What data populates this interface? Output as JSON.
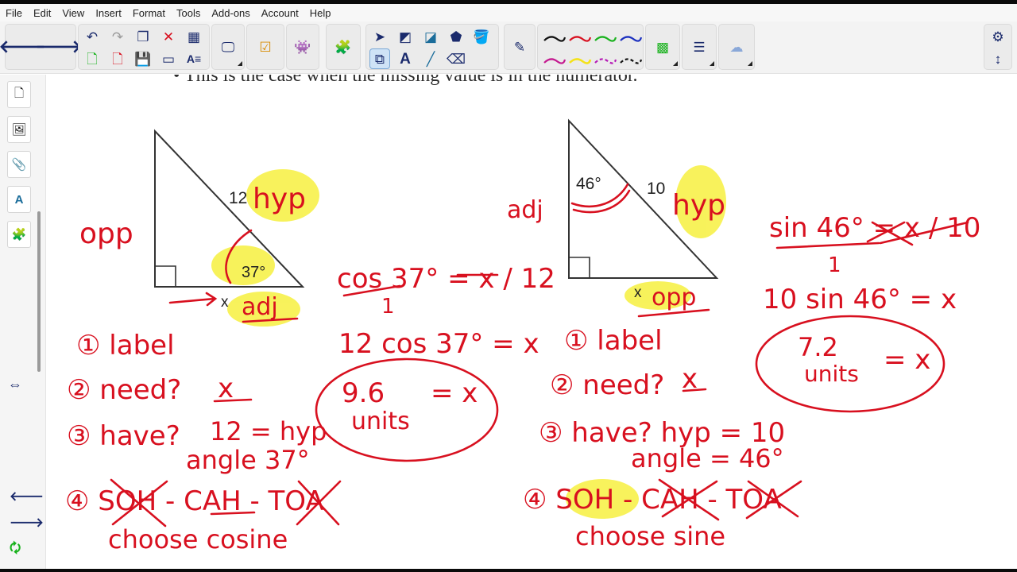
{
  "menu": [
    "File",
    "Edit",
    "View",
    "Insert",
    "Format",
    "Tools",
    "Add-ons",
    "Account",
    "Help"
  ],
  "toolbar": {
    "icons": [
      "back-arrow-icon",
      "forward-arrow-icon",
      "undo-icon",
      "redo-icon",
      "new-page-icon",
      "new-slide-icon",
      "close-red-x-icon",
      "delete-page-icon",
      "table-icon",
      "save-icon",
      "screen-icon",
      "text-format-icon",
      "presentation-icon",
      "checklist-icon",
      "robot-icon",
      "puzzle-icon",
      "select-arrow-icon",
      "sticky-note-icon",
      "shapes-icon",
      "polygon-icon",
      "fill-bucket-icon",
      "multi-select-icon",
      "text-tool-icon",
      "line-tool-icon",
      "eraser-icon",
      "pen-icon",
      "color-palette-icon",
      "line-weight-icon",
      "cloud-user-icon",
      "gear-icon",
      "up-down-arrow-icon"
    ],
    "pen_colors": [
      "#111111",
      "#d8101f",
      "#19b21d",
      "#1b2fbf",
      "#c4198f",
      "#f4e21a",
      "#b51ab5",
      "#111111"
    ]
  },
  "sidebar": {
    "icons": [
      "page-icon",
      "image-icon",
      "paperclip-icon",
      "text-style-icon",
      "puzzle-icon"
    ],
    "expand_icon": "left-right-arrow-icon",
    "nav_icons": [
      "left-arrow-icon",
      "right-arrow-icon",
      "page-refresh-icon"
    ]
  },
  "document": {
    "text": "This is the case when the missing value is in the numerator."
  },
  "left_problem": {
    "side_hyp": "12",
    "angle": "37°",
    "unknown": "x",
    "label_hyp": "hyp",
    "label_opp": "opp",
    "label_adj": "adj",
    "work": [
      "cos 37° = x / 12",
      "1",
      "12 cos 37° = x"
    ],
    "answer_line1": "9.6",
    "answer_eq": "= x",
    "answer_line2": "units",
    "steps": {
      "s1": "① label",
      "s2": "② need?",
      "s2_val": "x",
      "s3": "③ have?",
      "s3_val": "12 = hyp",
      "s3_val2": "angle 37°",
      "s4": "④ SOH - CAH - TOA",
      "s4_choose": "choose cosine"
    }
  },
  "right_problem": {
    "side_hyp": "10",
    "angle": "46°",
    "unknown": "x",
    "label_hyp": "hyp",
    "label_adj": "adj",
    "label_opp": "opp",
    "work": [
      "sin 46° = x / 10",
      "1",
      "10 sin 46° = x"
    ],
    "answer_line1": "7.2",
    "answer_eq": "= x",
    "answer_line2": "units",
    "steps": {
      "s1": "① label",
      "s2": "② need?",
      "s2_val": "x",
      "s3": "③ have? hyp = 10",
      "s3_val2": "angle = 46°",
      "s4": "④ SOH - CAH - TOA",
      "s4_choose": "choose sine"
    }
  },
  "colors": {
    "ink_red": "#d8101f",
    "highlight_yellow": "#f7f14a",
    "accent_blue": "#1b2fbf"
  }
}
